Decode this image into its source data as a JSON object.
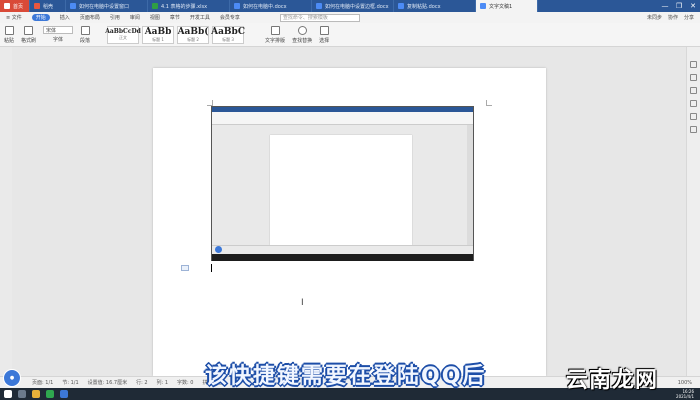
{
  "tabs": [
    {
      "label": "首页",
      "color": "#d94a38"
    },
    {
      "label": "稻壳",
      "color": "#e9573f"
    },
    {
      "label": "如何在电脑中设置窗口",
      "color": "#4c8bf5"
    },
    {
      "label": "4.1 表格的步骤.xlsx",
      "color": "#2f9e44"
    },
    {
      "label": "如何在电脑中.docx",
      "color": "#4c8bf5"
    },
    {
      "label": "如何在电脑中设置边框.docx",
      "color": "#4c8bf5"
    },
    {
      "label": "复制粘贴.docx",
      "color": "#4c8bf5"
    },
    {
      "label": "文字文稿1",
      "color": "#4c8bf5"
    }
  ],
  "window_controls": [
    "—",
    "❐",
    "✕"
  ],
  "menu": {
    "items": [
      "≡ 文件",
      "开始",
      "插入",
      "页面布局",
      "引用",
      "审阅",
      "视图",
      "章节",
      "开发工具",
      "会员专享"
    ],
    "active_index": 1,
    "search_placeholder": "查找命令、搜索模板",
    "right": [
      "未同步",
      "协作",
      "分享"
    ]
  },
  "ribbon": {
    "groups": [
      "粘贴",
      "格式刷",
      "字体",
      "段落"
    ],
    "font_name": "宋体",
    "styles": [
      {
        "sample": "AaBbCcDd",
        "caption": "正文"
      },
      {
        "sample": "AaBb",
        "caption": "标题 1"
      },
      {
        "sample": "AaBb(",
        "caption": "标题 2"
      },
      {
        "sample": "AaBbC",
        "caption": "标题 3"
      }
    ],
    "tools": [
      "文字排版",
      "查找替换",
      "选择"
    ]
  },
  "statusbar": {
    "items": [
      "页面: 1/1",
      "节: 1/1",
      "设置值: 16.7厘米",
      "行: 2",
      "列: 1",
      "字数: 0",
      "拼写检查"
    ],
    "zoom": "100%"
  },
  "taskbar": {
    "clock_time": "16:26",
    "clock_date": "2021/4/1"
  },
  "overlay": {
    "subtitle": "该快捷键需要在登陆QQ后",
    "watermark": "云南龙网"
  }
}
